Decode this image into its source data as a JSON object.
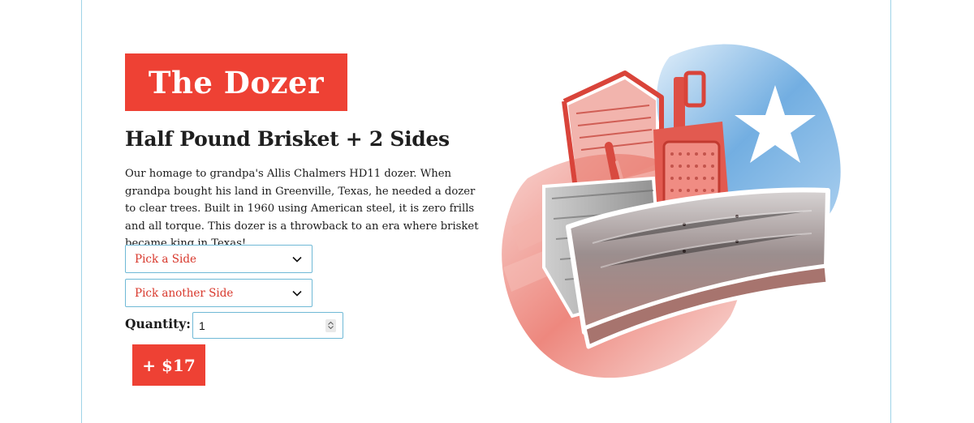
{
  "product": {
    "name": "The Dozer",
    "subtitle": "Half Pound Brisket + 2 Sides",
    "description": "Our homage to grandpa's Allis Chalmers HD11 dozer. When grandpa bought his land in Greenville, Texas, he needed a dozer to clear trees. Built in 1960 using American steel, it is zero frills and all torque. This dozer is a throwback to an era where brisket became king in Texas!"
  },
  "side_select_1": {
    "value": "Pick a Side",
    "icon": "chevron-down-icon"
  },
  "side_select_2": {
    "value": "Pick another Side",
    "icon": "chevron-down-icon"
  },
  "quantity": {
    "label": "Quantity:",
    "value": "1"
  },
  "add_button": {
    "label": "+ $17"
  },
  "illustration": {
    "subject": "red bulldozer over Texas flag watercolor",
    "icon": "bulldozer-illustration"
  },
  "colors": {
    "accent": "#ee4134",
    "select_text": "#d8382c",
    "border": "#6fb9d6",
    "frame": "#9fd3e8",
    "flag_blue": "#3f8fd2"
  }
}
